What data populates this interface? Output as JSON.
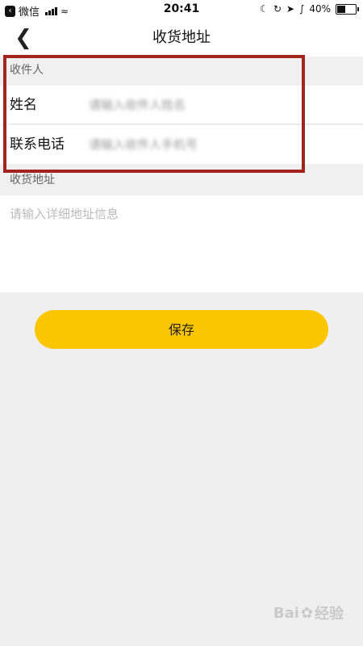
{
  "status_bar": {
    "back_app": "微信",
    "time": "20:41",
    "battery": "40%",
    "battery_level": 0.4
  },
  "nav": {
    "back_icon": "chevron-left-icon",
    "title": "收货地址"
  },
  "form": {
    "recipient_section": "收件人",
    "name_label": "姓名",
    "name_placeholder": "请输入收件人姓名",
    "phone_label": "联系电话",
    "phone_placeholder": "请输入收件人手机号",
    "address_section": "收货地址",
    "address_placeholder": "请输入详细地址信息"
  },
  "actions": {
    "save_label": "保存"
  },
  "watermark": {
    "text": "Bai",
    "suffix": "经验"
  },
  "colors": {
    "accent": "#fbc500",
    "highlight_border": "#a3231f"
  }
}
